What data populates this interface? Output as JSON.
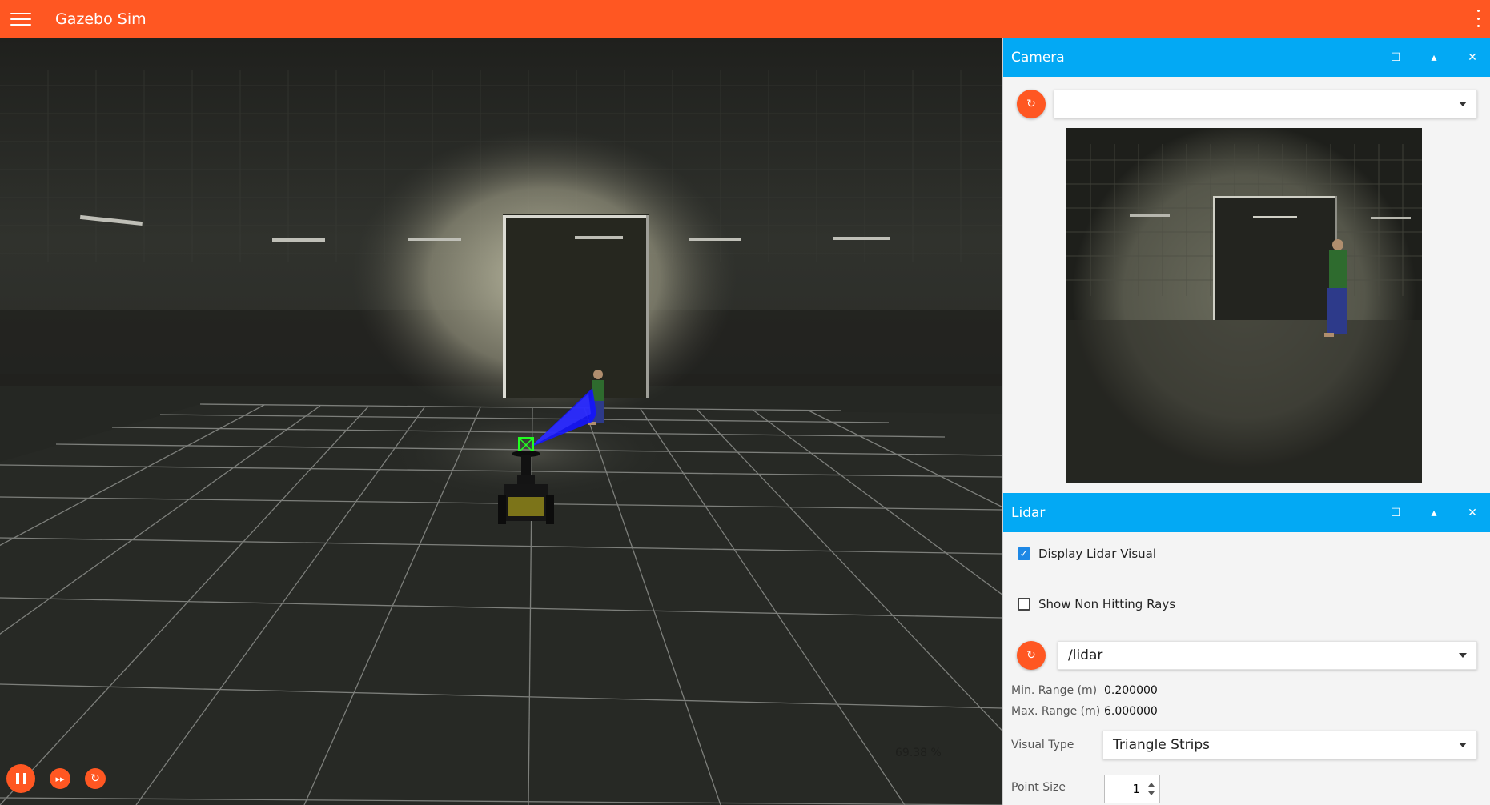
{
  "app": {
    "title": "Gazebo Sim"
  },
  "scene": {
    "rtf_text": "69.38 %",
    "controls": {
      "play_pause": "pause-icon",
      "step": "fast-forward-icon",
      "reset": "reset-icon"
    }
  },
  "camera_panel": {
    "title": "Camera",
    "topic_value": "",
    "header_icons": [
      "maximize-icon",
      "collapse-icon",
      "close-icon"
    ]
  },
  "lidar_panel": {
    "title": "Lidar",
    "display_visual": {
      "label": "Display Lidar Visual",
      "checked": true
    },
    "non_hitting": {
      "label": "Show Non Hitting Rays",
      "checked": false
    },
    "topic_value": "/lidar",
    "min_range_label": "Min. Range (m)",
    "min_range_value": "0.200000",
    "max_range_label": "Max. Range (m)",
    "max_range_value": "6.000000",
    "visual_type_label": "Visual Type",
    "visual_type_value": "Triangle Strips",
    "point_size_label": "Point Size",
    "point_size_value": "1"
  },
  "colors": {
    "accent": "#ff5722",
    "panel_header": "#03a9f4",
    "lidar_rays": "#1414ff",
    "checkbox": "#1e88e5"
  }
}
